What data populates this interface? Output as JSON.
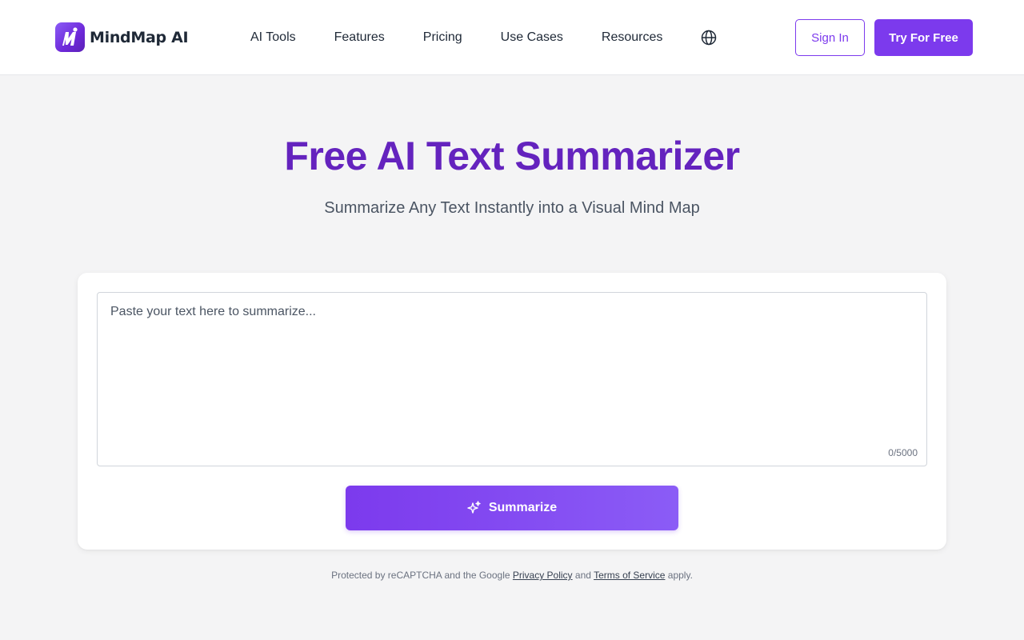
{
  "brand": {
    "name": "MindMap AI",
    "accent_color": "#7c3aed",
    "title_color": "#6423be"
  },
  "nav": {
    "items": [
      {
        "label": "AI Tools"
      },
      {
        "label": "Features"
      },
      {
        "label": "Pricing"
      },
      {
        "label": "Use Cases"
      },
      {
        "label": "Resources"
      }
    ],
    "language_icon": "globe-icon"
  },
  "header_actions": {
    "sign_in_label": "Sign In",
    "try_label": "Try For Free"
  },
  "hero": {
    "title": "Free AI Text Summarizer",
    "subtitle": "Summarize Any Text Instantly into a Visual Mind Map"
  },
  "summarizer": {
    "input_placeholder": "Paste your text here to summarize...",
    "input_value": "",
    "char_count": "0/5000",
    "button_label": "Summarize",
    "button_icon": "sparkle-icon"
  },
  "recaptcha": {
    "prefix": "Protected by reCAPTCHA and the Google",
    "privacy_label": "Privacy Policy",
    "and": "and",
    "terms_label": "Terms of Service",
    "suffix": "apply."
  }
}
